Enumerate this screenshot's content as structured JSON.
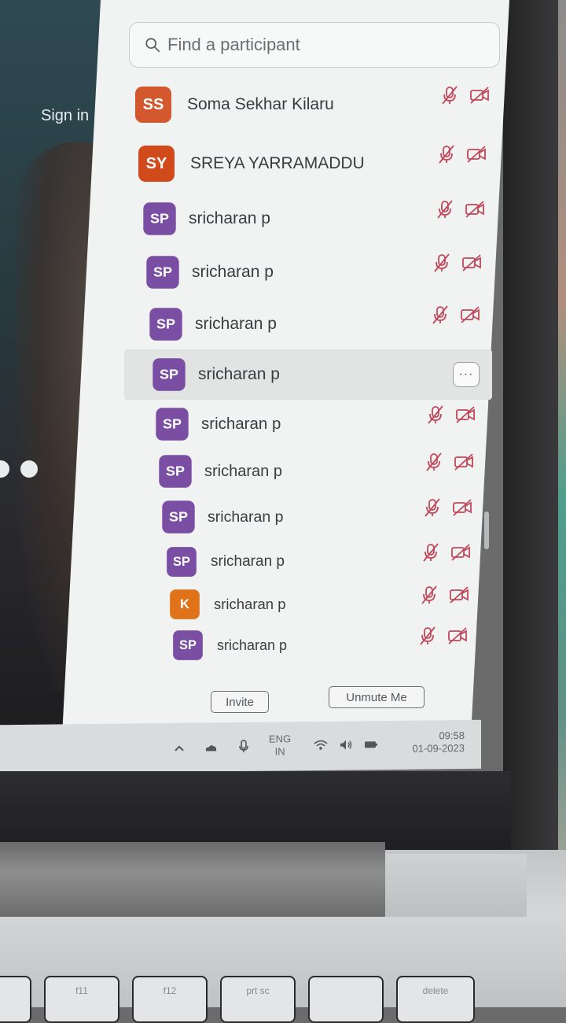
{
  "meeting": {
    "sign_in_label": "Sign in"
  },
  "participants_panel": {
    "search_placeholder": "Find a participant",
    "participants": [
      {
        "initials": "SS",
        "name": "Soma Sekhar Kilaru",
        "avatar_color": "#d4582e"
      },
      {
        "initials": "SY",
        "name": "SREYA YARRAMADDU",
        "avatar_color": "#d14a1c"
      },
      {
        "initials": "SP",
        "name": "sricharan p",
        "avatar_color": "#7a4fa3"
      },
      {
        "initials": "SP",
        "name": "sricharan p",
        "avatar_color": "#7a4fa3"
      },
      {
        "initials": "SP",
        "name": "sricharan p",
        "avatar_color": "#7a4fa3"
      },
      {
        "initials": "SP",
        "name": "sricharan p",
        "avatar_color": "#7a4fa3"
      },
      {
        "initials": "SP",
        "name": "sricharan p",
        "avatar_color": "#7a4fa3"
      },
      {
        "initials": "SP",
        "name": "sricharan p",
        "avatar_color": "#7a4fa3"
      },
      {
        "initials": "SP",
        "name": "sricharan p",
        "avatar_color": "#7a4fa3"
      },
      {
        "initials": "SP",
        "name": "sricharan p",
        "avatar_color": "#7a4fa3"
      },
      {
        "initials": "K",
        "name": "sricharan p",
        "avatar_color": "#e0731a"
      },
      {
        "initials": "SP",
        "name": "sricharan p",
        "avatar_color": "#7a4fa3"
      }
    ],
    "more_options_label": "···",
    "invite_label": "Invite",
    "unmute_label": "Unmute Me",
    "muted_icon_color": "#c0485a"
  },
  "taskbar": {
    "language_line1": "ENG",
    "language_line2": "IN",
    "time": "09:58",
    "date": "01-09-2023"
  },
  "keyboard": {
    "keys": [
      "f11",
      "f12",
      "prt sc",
      "",
      "delete"
    ]
  }
}
